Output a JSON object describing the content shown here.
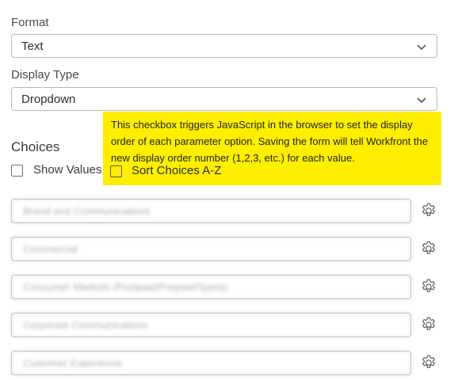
{
  "format": {
    "label": "Format",
    "value": "Text"
  },
  "display_type": {
    "label": "Display Type",
    "value": "Dropdown"
  },
  "choices": {
    "title": "Choices",
    "show_values_label": "Show Values",
    "sort_label": "Sort Choices A-Z",
    "items": [
      "Brand and Communications",
      "Commercial",
      "Consumer Markets (Postpaid/Prepaid/Sprint)",
      "Corporate Communications",
      "Customer Experience"
    ]
  },
  "callout": {
    "text": "This checkbox triggers JavaScript in the browser to set the display order of each parameter option. Saving the form will tell Workfront the new display order number (1,2,3, etc.) for each value."
  },
  "icons": {
    "select_arrow": "chevron-down-icon",
    "row_settings": "gear-icon"
  },
  "colors": {
    "callout_background": "#ffee00"
  }
}
